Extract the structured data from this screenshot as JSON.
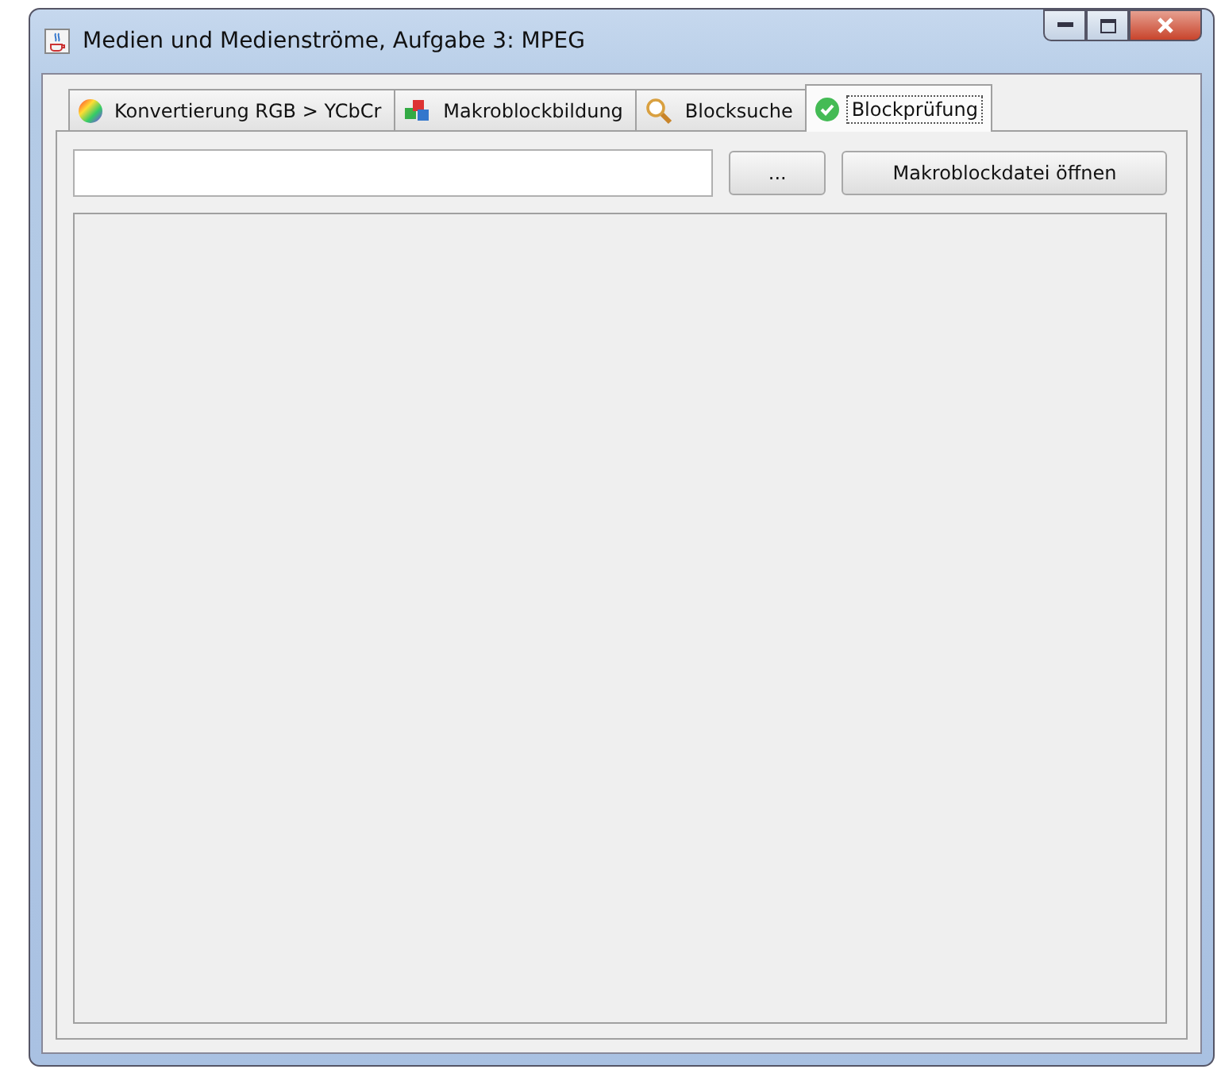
{
  "window": {
    "title": "Medien und Medienströme, Aufgabe 3: MPEG"
  },
  "tabs": [
    {
      "label": "Konvertierung RGB > YCbCr",
      "selected": false,
      "kind": "color"
    },
    {
      "label": "Makroblockbildung",
      "selected": false,
      "kind": "cubes"
    },
    {
      "label": "Blocksuche",
      "selected": false,
      "kind": "search"
    },
    {
      "label": "Blockprüfung",
      "selected": true,
      "kind": "check"
    }
  ],
  "toolbar": {
    "browse_button": "...",
    "open_button": "Makroblockdatei öffnen"
  }
}
